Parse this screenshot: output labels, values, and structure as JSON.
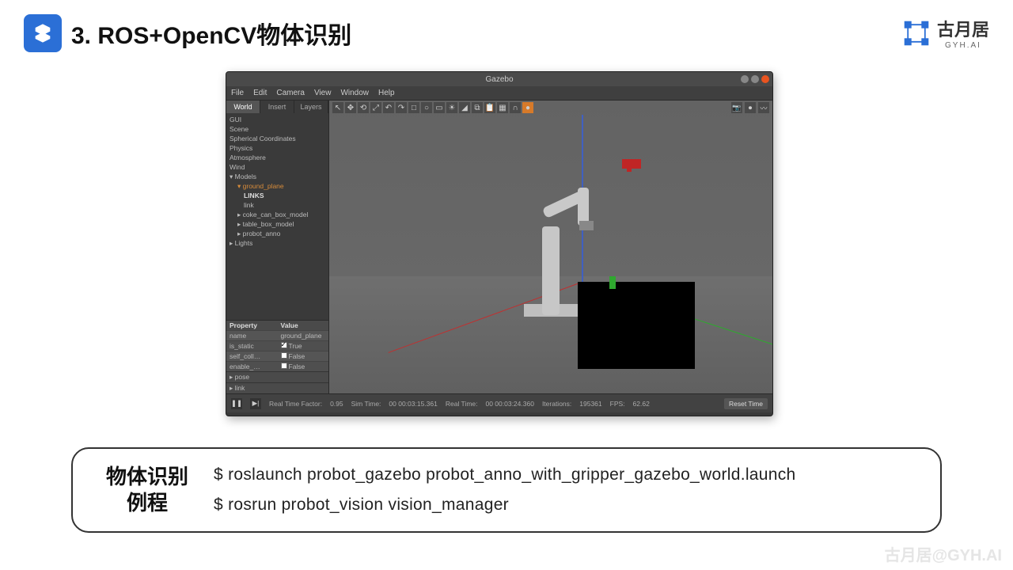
{
  "header": {
    "title": "3. ROS+OpenCV物体识别",
    "logo_text": "古月居",
    "logo_sub": "GYH.AI"
  },
  "window": {
    "title": "Gazebo",
    "menu": [
      "File",
      "Edit",
      "Camera",
      "View",
      "Window",
      "Help"
    ],
    "sidebar": {
      "tabs": [
        "World",
        "Insert",
        "Layers"
      ],
      "tree": {
        "items": [
          "GUI",
          "Scene",
          "Spherical Coordinates",
          "Physics",
          "Atmosphere",
          "Wind"
        ],
        "models_label": "Models",
        "selected": "ground_plane",
        "links_label": "LINKS",
        "link_label": "link",
        "children": [
          "coke_can_box_model",
          "table_box_model",
          "probot_anno"
        ],
        "lights_label": "Lights"
      },
      "props": {
        "header": [
          "Property",
          "Value"
        ],
        "rows": [
          {
            "k": "name",
            "v": "ground_plane"
          },
          {
            "k": "is_static",
            "v": "True",
            "chk": true
          },
          {
            "k": "self_coll…",
            "v": "False",
            "chk": false
          },
          {
            "k": "enable_…",
            "v": "False",
            "chk": false
          }
        ],
        "expanders": [
          "pose",
          "link"
        ]
      }
    },
    "status": {
      "rtf_label": "Real Time Factor:",
      "rtf": "0.95",
      "sim_label": "Sim Time:",
      "sim": "00 00:03:15.361",
      "real_label": "Real Time:",
      "real": "00 00:03:24.360",
      "iter_label": "Iterations:",
      "iter": "195361",
      "fps_label": "FPS:",
      "fps": "62.62",
      "reset": "Reset Time"
    }
  },
  "example": {
    "label_line1": "物体识别",
    "label_line2": "例程",
    "cmd1": "$ roslaunch probot_gazebo probot_anno_with_gripper_gazebo_world.launch",
    "cmd2": "$ rosrun probot_vision vision_manager"
  },
  "watermark": "古月居@GYH.AI"
}
